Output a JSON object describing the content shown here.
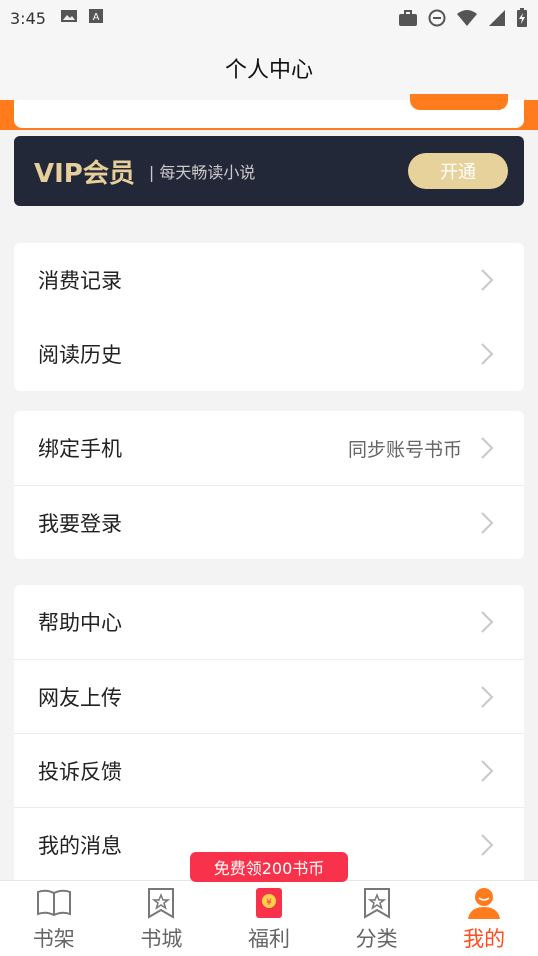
{
  "status_bar": {
    "time": "3:45"
  },
  "header": {
    "title": "个人中心"
  },
  "vip": {
    "title": "VIP会员",
    "tagline": "| 每天畅读小说",
    "button_label": "开通"
  },
  "menu_groups": [
    {
      "items": [
        {
          "label": "消费记录"
        },
        {
          "label": "阅读历史"
        }
      ]
    },
    {
      "items": [
        {
          "label": "绑定手机",
          "right_text": "同步账号书币"
        },
        {
          "label": "我要登录"
        }
      ]
    },
    {
      "items": [
        {
          "label": "帮助中心"
        },
        {
          "label": "网友上传"
        },
        {
          "label": "投诉反馈"
        },
        {
          "label": "我的消息"
        }
      ]
    }
  ],
  "promo": {
    "label": "免费领200书币"
  },
  "tabbar": {
    "items": [
      {
        "label": "书架",
        "icon": "book-icon"
      },
      {
        "label": "书城",
        "icon": "store-icon"
      },
      {
        "label": "福利",
        "icon": "red-envelope-icon"
      },
      {
        "label": "分类",
        "icon": "category-icon"
      },
      {
        "label": "我的",
        "icon": "profile-icon"
      }
    ],
    "active_index": 4,
    "active_color": "#ff4d1c"
  },
  "colors": {
    "accent": "#ff7b1c",
    "vip_bg": "#232838",
    "vip_gold": "#e6cf9a"
  }
}
